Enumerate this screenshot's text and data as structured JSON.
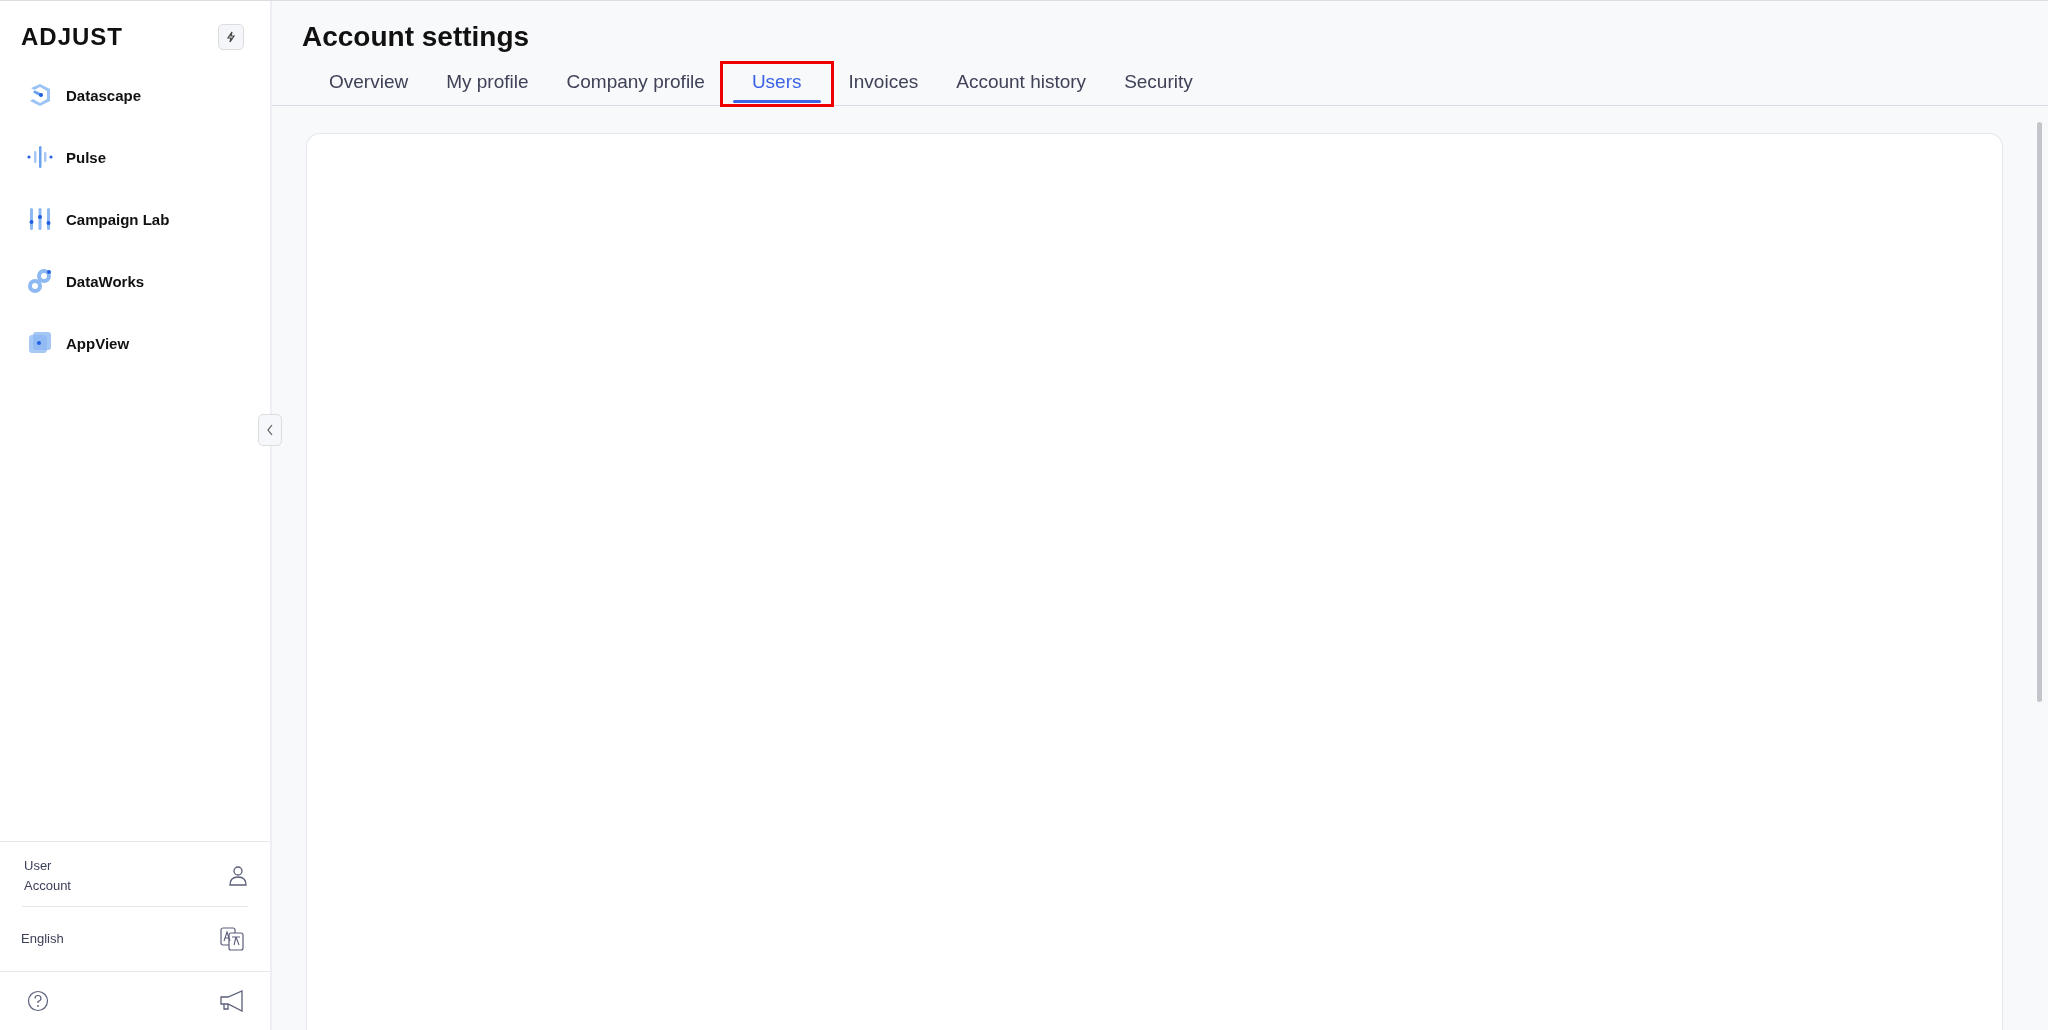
{
  "sidebar": {
    "logo": "ADJUST",
    "items": [
      {
        "label": "Datascape",
        "kind": "datascape"
      },
      {
        "label": "Pulse",
        "kind": "pulse"
      },
      {
        "label": "Campaign Lab",
        "kind": "campaign"
      },
      {
        "label": "DataWorks",
        "kind": "dataworks"
      },
      {
        "label": "AppView",
        "kind": "appview"
      }
    ],
    "account": "User\nAccount",
    "language": "English"
  },
  "page": {
    "title": "Account settings",
    "tabs": [
      {
        "label": "Overview",
        "selected": false,
        "highlighted": false
      },
      {
        "label": "My profile",
        "selected": false,
        "highlighted": false
      },
      {
        "label": "Company profile",
        "selected": false,
        "highlighted": false
      },
      {
        "label": "Users",
        "selected": true,
        "highlighted": true
      },
      {
        "label": "Invoices",
        "selected": false,
        "highlighted": false
      },
      {
        "label": "Account history",
        "selected": false,
        "highlighted": false
      },
      {
        "label": "Security",
        "selected": false,
        "highlighted": false
      }
    ]
  }
}
